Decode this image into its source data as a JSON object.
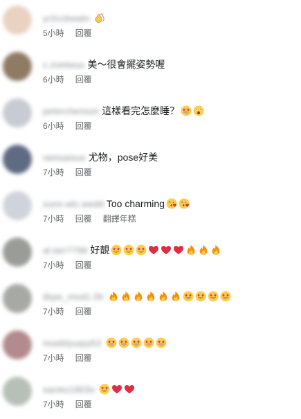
{
  "comments": [
    {
      "username": "yr2ccbwatn",
      "text": "",
      "emojis": [
        "clapping-hands"
      ],
      "time": "5小時",
      "actions": [
        "回覆"
      ],
      "avatar_color": "#e9d2c2"
    },
    {
      "username": "c.zoetwuu",
      "text": "美～很會擺姿勢喔",
      "emojis": [],
      "time": "6小時",
      "actions": [
        "回覆"
      ],
      "avatar_color": "#8f7b64"
    },
    {
      "username": "peterchenson",
      "text": "這樣看完怎麼睡？",
      "emojis": [
        "star-struck",
        "astonished"
      ],
      "time": "6小時",
      "actions": [
        "回覆"
      ],
      "avatar_color": "#c7cbd3"
    },
    {
      "username": "ramsaisuo",
      "text": "尤物，pose好美",
      "emojis": [],
      "time": "7小時",
      "actions": [
        "回覆"
      ],
      "avatar_color": "#5f6b82"
    },
    {
      "username": "sunn.wlc.wedd",
      "text": "Too charming",
      "emojis": [
        "kissing-heart",
        "kissing-heart"
      ],
      "time": "7小時",
      "actions": [
        "回覆",
        "翻譯年糕"
      ],
      "avatar_color": "#cfd3dc"
    },
    {
      "username": "al.tarr7799",
      "text": "好靚",
      "emojis": [
        "star-struck",
        "star-struck",
        "star-struck",
        "red-heart",
        "red-heart",
        "red-heart",
        "fire",
        "fire",
        "fire"
      ],
      "time": "7小時",
      "actions": [
        "回覆"
      ],
      "avatar_color": "#9a9c98"
    },
    {
      "username": "tikpe_mod1.0h",
      "text": "",
      "emojis": [
        "fire",
        "fire",
        "fire",
        "fire",
        "fire",
        "fire",
        "star-struck",
        "star-struck",
        "star-struck",
        "star-struck"
      ],
      "time": "7小時",
      "actions": [
        "回覆"
      ],
      "avatar_color": "#a7a9a5"
    },
    {
      "username": "moeblyuqrp52",
      "text": "",
      "emojis": [
        "star-struck",
        "star-struck",
        "star-struck",
        "star-struck",
        "star-struck"
      ],
      "time": "7小時",
      "actions": [
        "回覆"
      ],
      "avatar_color": "#b38a8d"
    },
    {
      "username": "sactez1803s",
      "text": "",
      "emojis": [
        "star-struck",
        "red-heart",
        "red-heart"
      ],
      "time": "7小時",
      "actions": [
        "回覆"
      ],
      "avatar_color": "#b7c0b7"
    }
  ],
  "emoji_colors": {
    "face": "#FFCC4D",
    "heart": "#DD2E44",
    "fire": "#F4900C",
    "fire_inner": "#FFCC4D"
  }
}
